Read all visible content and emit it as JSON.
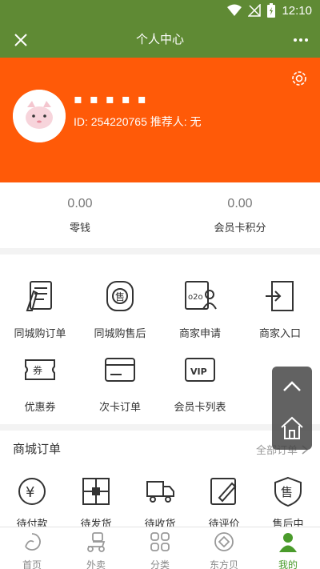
{
  "status_bar": {
    "time": "12:10"
  },
  "header": {
    "title": "个人中心"
  },
  "profile": {
    "name_masked": "▪ ▪  ▪ ▪  ▪",
    "id_line": "ID: 254220765   推荐人: 无"
  },
  "wallet": [
    {
      "value": "0.00",
      "label": "零钱"
    },
    {
      "value": "0.00",
      "label": "会员卡积分"
    }
  ],
  "menu": [
    {
      "label": "同城购订单",
      "icon": "order-list-icon"
    },
    {
      "label": "同城购售后",
      "icon": "after-sale-icon"
    },
    {
      "label": "商家申请",
      "icon": "merchant-apply-icon"
    },
    {
      "label": "商家入口",
      "icon": "merchant-entrance-icon"
    },
    {
      "label": "优惠券",
      "icon": "coupon-icon"
    },
    {
      "label": "次卡订单",
      "icon": "card-order-icon"
    },
    {
      "label": "会员卡列表",
      "icon": "vip-card-icon"
    }
  ],
  "orders": {
    "title": "商城订单",
    "all_label": "全部订单",
    "items": [
      {
        "label": "待付款",
        "icon": "pending-payment-icon"
      },
      {
        "label": "待发货",
        "icon": "pending-shipment-icon"
      },
      {
        "label": "待收货",
        "icon": "pending-receipt-icon"
      },
      {
        "label": "待评价",
        "icon": "pending-review-icon"
      },
      {
        "label": "售后中",
        "icon": "after-sale-icon"
      }
    ]
  },
  "tabbar": [
    {
      "label": "首页",
      "icon": "home-icon"
    },
    {
      "label": "外卖",
      "icon": "takeout-icon"
    },
    {
      "label": "分类",
      "icon": "category-icon"
    },
    {
      "label": "东方贝",
      "icon": "coin-icon"
    },
    {
      "label": "我的",
      "icon": "profile-icon",
      "active": true
    }
  ],
  "colors": {
    "header_green": "#5f8a34",
    "profile_orange": "#ff5a08",
    "active_green": "#4a9b2b"
  }
}
